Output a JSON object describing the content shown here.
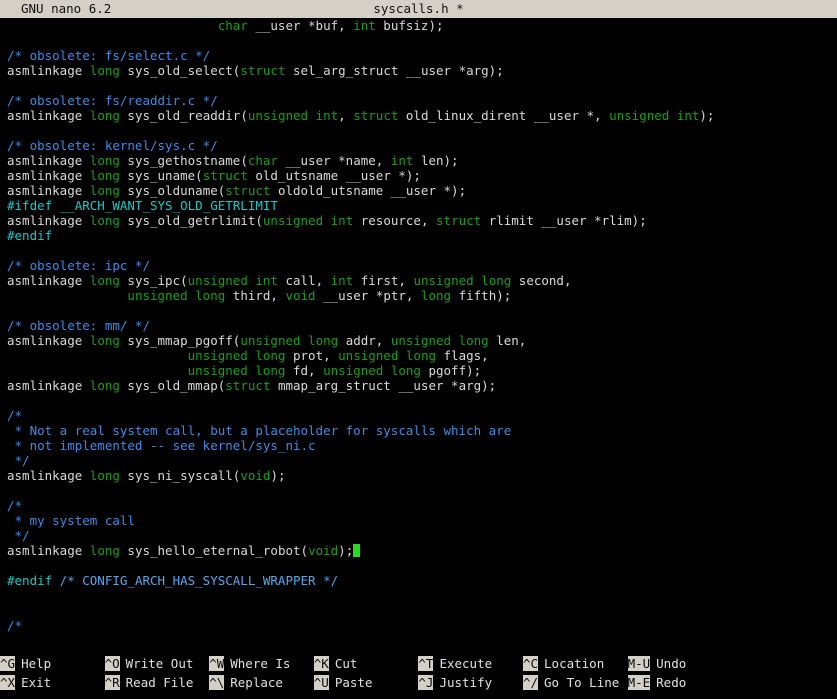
{
  "titlebar": {
    "version": "GNU nano 6.2",
    "filename": "syscalls.h *"
  },
  "colors": {
    "titlebar_bg": "#d4d0c8",
    "titlebar_fg": "#101010",
    "background": "#000000",
    "plain": "#d9d9d9",
    "comment": "#3b8ce8",
    "keyword": "#14a014",
    "preproc": "#18c8c8",
    "cursor": "#22dd22"
  },
  "editor": {
    "lines": [
      {
        "indent": 28,
        "segments": [
          {
            "t": "char",
            "c": "keyword"
          },
          {
            "t": " __user *buf, ",
            "c": "plain"
          },
          {
            "t": "int",
            "c": "keyword"
          },
          {
            "t": " bufsiz);",
            "c": "plain"
          }
        ]
      },
      {
        "indent": 0,
        "segments": []
      },
      {
        "indent": 0,
        "segments": [
          {
            "t": "/* obsolete: fs/select.c */",
            "c": "comment"
          }
        ]
      },
      {
        "indent": 0,
        "segments": [
          {
            "t": "asmlinkage ",
            "c": "plain"
          },
          {
            "t": "long",
            "c": "keyword"
          },
          {
            "t": " sys_old_select(",
            "c": "plain"
          },
          {
            "t": "struct",
            "c": "keyword"
          },
          {
            "t": " sel_arg_struct __user *arg);",
            "c": "plain"
          }
        ]
      },
      {
        "indent": 0,
        "segments": []
      },
      {
        "indent": 0,
        "segments": [
          {
            "t": "/* obsolete: fs/readdir.c */",
            "c": "comment"
          }
        ]
      },
      {
        "indent": 0,
        "segments": [
          {
            "t": "asmlinkage ",
            "c": "plain"
          },
          {
            "t": "long",
            "c": "keyword"
          },
          {
            "t": " sys_old_readdir(",
            "c": "plain"
          },
          {
            "t": "unsigned int",
            "c": "keyword"
          },
          {
            "t": ", ",
            "c": "plain"
          },
          {
            "t": "struct",
            "c": "keyword"
          },
          {
            "t": " old_linux_dirent __user *, ",
            "c": "plain"
          },
          {
            "t": "unsigned int",
            "c": "keyword"
          },
          {
            "t": ");",
            "c": "plain"
          }
        ]
      },
      {
        "indent": 0,
        "segments": []
      },
      {
        "indent": 0,
        "segments": [
          {
            "t": "/* obsolete: kernel/sys.c */",
            "c": "comment"
          }
        ]
      },
      {
        "indent": 0,
        "segments": [
          {
            "t": "asmlinkage ",
            "c": "plain"
          },
          {
            "t": "long",
            "c": "keyword"
          },
          {
            "t": " sys_gethostname(",
            "c": "plain"
          },
          {
            "t": "char",
            "c": "keyword"
          },
          {
            "t": " __user *name, ",
            "c": "plain"
          },
          {
            "t": "int",
            "c": "keyword"
          },
          {
            "t": " len);",
            "c": "plain"
          }
        ]
      },
      {
        "indent": 0,
        "segments": [
          {
            "t": "asmlinkage ",
            "c": "plain"
          },
          {
            "t": "long",
            "c": "keyword"
          },
          {
            "t": " sys_uname(",
            "c": "plain"
          },
          {
            "t": "struct",
            "c": "keyword"
          },
          {
            "t": " old_utsname __user *);",
            "c": "plain"
          }
        ]
      },
      {
        "indent": 0,
        "segments": [
          {
            "t": "asmlinkage ",
            "c": "plain"
          },
          {
            "t": "long",
            "c": "keyword"
          },
          {
            "t": " sys_olduname(",
            "c": "plain"
          },
          {
            "t": "struct",
            "c": "keyword"
          },
          {
            "t": " oldold_utsname __user *);",
            "c": "plain"
          }
        ]
      },
      {
        "indent": 0,
        "segments": [
          {
            "t": "#ifdef __ARCH_WANT_SYS_OLD_GETRLIMIT",
            "c": "preproc"
          }
        ]
      },
      {
        "indent": 0,
        "segments": [
          {
            "t": "asmlinkage ",
            "c": "plain"
          },
          {
            "t": "long",
            "c": "keyword"
          },
          {
            "t": " sys_old_getrlimit(",
            "c": "plain"
          },
          {
            "t": "unsigned int",
            "c": "keyword"
          },
          {
            "t": " resource, ",
            "c": "plain"
          },
          {
            "t": "struct",
            "c": "keyword"
          },
          {
            "t": " rlimit __user *rlim);",
            "c": "plain"
          }
        ]
      },
      {
        "indent": 0,
        "segments": [
          {
            "t": "#endif",
            "c": "preproc"
          }
        ]
      },
      {
        "indent": 0,
        "segments": []
      },
      {
        "indent": 0,
        "segments": [
          {
            "t": "/* obsolete: ipc */",
            "c": "comment"
          }
        ]
      },
      {
        "indent": 0,
        "segments": [
          {
            "t": "asmlinkage ",
            "c": "plain"
          },
          {
            "t": "long",
            "c": "keyword"
          },
          {
            "t": " sys_ipc(",
            "c": "plain"
          },
          {
            "t": "unsigned int",
            "c": "keyword"
          },
          {
            "t": " call, ",
            "c": "plain"
          },
          {
            "t": "int",
            "c": "keyword"
          },
          {
            "t": " first, ",
            "c": "plain"
          },
          {
            "t": "unsigned long",
            "c": "keyword"
          },
          {
            "t": " second,",
            "c": "plain"
          }
        ]
      },
      {
        "indent": 16,
        "segments": [
          {
            "t": "unsigned long",
            "c": "keyword"
          },
          {
            "t": " third, ",
            "c": "plain"
          },
          {
            "t": "void",
            "c": "keyword"
          },
          {
            "t": " __user *ptr, ",
            "c": "plain"
          },
          {
            "t": "long",
            "c": "keyword"
          },
          {
            "t": " fifth);",
            "c": "plain"
          }
        ]
      },
      {
        "indent": 0,
        "segments": []
      },
      {
        "indent": 0,
        "segments": [
          {
            "t": "/* obsolete: mm/ */",
            "c": "comment"
          }
        ]
      },
      {
        "indent": 0,
        "segments": [
          {
            "t": "asmlinkage ",
            "c": "plain"
          },
          {
            "t": "long",
            "c": "keyword"
          },
          {
            "t": " sys_mmap_pgoff(",
            "c": "plain"
          },
          {
            "t": "unsigned long",
            "c": "keyword"
          },
          {
            "t": " addr, ",
            "c": "plain"
          },
          {
            "t": "unsigned long",
            "c": "keyword"
          },
          {
            "t": " len,",
            "c": "plain"
          }
        ]
      },
      {
        "indent": 24,
        "segments": [
          {
            "t": "unsigned long",
            "c": "keyword"
          },
          {
            "t": " prot, ",
            "c": "plain"
          },
          {
            "t": "unsigned long",
            "c": "keyword"
          },
          {
            "t": " flags,",
            "c": "plain"
          }
        ]
      },
      {
        "indent": 24,
        "segments": [
          {
            "t": "unsigned long",
            "c": "keyword"
          },
          {
            "t": " fd, ",
            "c": "plain"
          },
          {
            "t": "unsigned long",
            "c": "keyword"
          },
          {
            "t": " pgoff);",
            "c": "plain"
          }
        ]
      },
      {
        "indent": 0,
        "segments": [
          {
            "t": "asmlinkage ",
            "c": "plain"
          },
          {
            "t": "long",
            "c": "keyword"
          },
          {
            "t": " sys_old_mmap(",
            "c": "plain"
          },
          {
            "t": "struct",
            "c": "keyword"
          },
          {
            "t": " mmap_arg_struct __user *arg);",
            "c": "plain"
          }
        ]
      },
      {
        "indent": 0,
        "segments": []
      },
      {
        "indent": 0,
        "segments": [
          {
            "t": "/*",
            "c": "comment"
          }
        ]
      },
      {
        "indent": 0,
        "segments": [
          {
            "t": " * Not a real system call, but a placeholder for syscalls which are",
            "c": "comment"
          }
        ]
      },
      {
        "indent": 0,
        "segments": [
          {
            "t": " * not implemented -- see kernel/sys_ni.c",
            "c": "comment"
          }
        ]
      },
      {
        "indent": 0,
        "segments": [
          {
            "t": " */",
            "c": "comment"
          }
        ]
      },
      {
        "indent": 0,
        "segments": [
          {
            "t": "asmlinkage ",
            "c": "plain"
          },
          {
            "t": "long",
            "c": "keyword"
          },
          {
            "t": " sys_ni_syscall(",
            "c": "plain"
          },
          {
            "t": "void",
            "c": "keyword"
          },
          {
            "t": ");",
            "c": "plain"
          }
        ]
      },
      {
        "indent": 0,
        "segments": []
      },
      {
        "indent": 0,
        "segments": [
          {
            "t": "/*",
            "c": "comment"
          }
        ]
      },
      {
        "indent": 0,
        "segments": [
          {
            "t": " * my system call",
            "c": "comment"
          }
        ]
      },
      {
        "indent": 0,
        "segments": [
          {
            "t": " */",
            "c": "comment"
          }
        ]
      },
      {
        "indent": 0,
        "cursor_at_end": true,
        "segments": [
          {
            "t": "asmlinkage ",
            "c": "plain"
          },
          {
            "t": "long",
            "c": "keyword"
          },
          {
            "t": " sys_hello_eternal_robot(",
            "c": "plain"
          },
          {
            "t": "void",
            "c": "keyword"
          },
          {
            "t": ");",
            "c": "plain"
          }
        ]
      },
      {
        "indent": 0,
        "segments": []
      },
      {
        "indent": 0,
        "segments": [
          {
            "t": "#endif",
            "c": "preproc"
          },
          {
            "t": " /* CONFIG_ARCH_HAS_SYSCALL_WRAPPER */",
            "c": "preproc-cmt"
          }
        ]
      },
      {
        "indent": 0,
        "segments": []
      },
      {
        "indent": 0,
        "segments": []
      },
      {
        "indent": 0,
        "segments": [
          {
            "t": "/*",
            "c": "comment"
          }
        ]
      }
    ]
  },
  "shortcuts": {
    "row1": [
      {
        "key": "^G",
        "label": "Help"
      },
      {
        "key": "^O",
        "label": "Write Out"
      },
      {
        "key": "^W",
        "label": "Where Is"
      },
      {
        "key": "^K",
        "label": "Cut"
      },
      {
        "key": "^T",
        "label": "Execute"
      },
      {
        "key": "^C",
        "label": "Location"
      },
      {
        "key": "M-U",
        "label": "Undo"
      }
    ],
    "row2": [
      {
        "key": "^X",
        "label": "Exit"
      },
      {
        "key": "^R",
        "label": "Read File"
      },
      {
        "key": "^\\",
        "label": "Replace"
      },
      {
        "key": "^U",
        "label": "Paste"
      },
      {
        "key": "^J",
        "label": "Justify"
      },
      {
        "key": "^/",
        "label": "Go To Line"
      },
      {
        "key": "M-E",
        "label": "Redo"
      }
    ]
  }
}
